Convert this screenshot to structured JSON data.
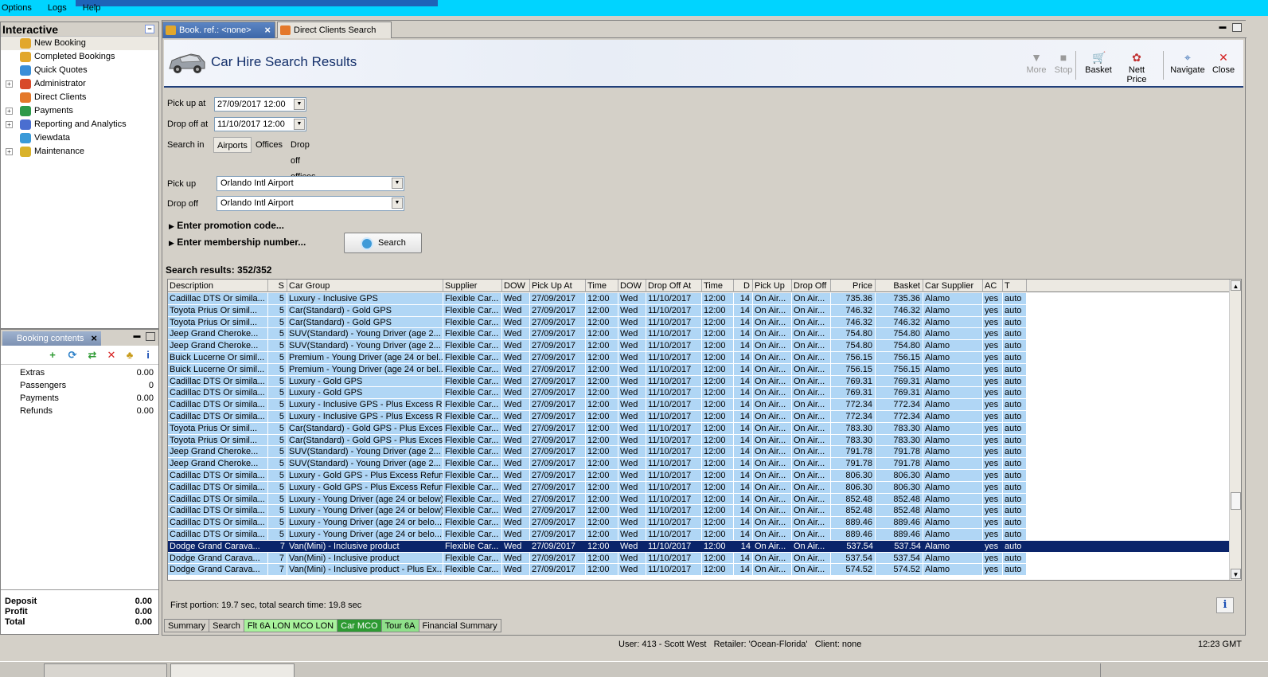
{
  "menu": {
    "options": "Options",
    "logs": "Logs",
    "help": "Help"
  },
  "leftnav": {
    "title": "Interactive",
    "collapse": "−",
    "items": [
      {
        "label": "New Booking",
        "icon": "palm-tree-icon",
        "expandable": false,
        "color": "#e2a72b",
        "selected": true
      },
      {
        "label": "Completed Bookings",
        "icon": "palm-tree-icon",
        "expandable": false,
        "color": "#e2a72b"
      },
      {
        "label": "Quick Quotes",
        "icon": "globe-icon",
        "expandable": false,
        "color": "#3a8ed8"
      },
      {
        "label": "Administrator",
        "icon": "person-icon",
        "expandable": true,
        "color": "#d84a2a"
      },
      {
        "label": "Direct Clients",
        "icon": "clients-icon",
        "expandable": false,
        "color": "#e4782a"
      },
      {
        "label": "Payments",
        "icon": "money-icon",
        "expandable": true,
        "color": "#2d9a4a"
      },
      {
        "label": "Reporting and Analytics",
        "icon": "chart-icon",
        "expandable": true,
        "color": "#4a6ed0"
      },
      {
        "label": "Viewdata",
        "icon": "viewdata-icon",
        "expandable": false,
        "color": "#3a9ad8"
      },
      {
        "label": "Maintenance",
        "icon": "books-icon",
        "expandable": true,
        "color": "#d9b22a"
      }
    ]
  },
  "booking": {
    "tab_label": "Booking contents",
    "close": "×",
    "tools": [
      {
        "icon": "add-icon",
        "glyph": "+",
        "color": "#2d9a32"
      },
      {
        "icon": "refresh-icon",
        "glyph": "⟳",
        "color": "#2a7fc8"
      },
      {
        "icon": "basket-icon",
        "glyph": "⇄",
        "color": "#2d9a32"
      },
      {
        "icon": "delete-icon",
        "glyph": "✕",
        "color": "#d62020"
      },
      {
        "icon": "palm-tree-icon",
        "glyph": "♣",
        "color": "#c89b1a"
      },
      {
        "icon": "info-icon",
        "glyph": "i",
        "color": "#1a4fb5"
      }
    ],
    "rows": [
      {
        "label": "Extras",
        "value": "0.00"
      },
      {
        "label": "Passengers",
        "value": "0"
      },
      {
        "label": "Payments",
        "value": "0.00"
      },
      {
        "label": "Refunds",
        "value": "0.00"
      }
    ],
    "totals": [
      {
        "label": "Deposit",
        "value": "0.00"
      },
      {
        "label": "Profit",
        "value": "0.00"
      },
      {
        "label": "Total",
        "value": "0.00"
      }
    ]
  },
  "tabs": [
    {
      "label": "Book. ref.: <none>",
      "active": true
    },
    {
      "label": "Direct Clients Search",
      "active": false
    }
  ],
  "header": {
    "title": "Car Hire Search Results"
  },
  "toolbar": [
    {
      "label": "More",
      "glyph": "▼",
      "disabled": true,
      "name": "more-button"
    },
    {
      "label": "Stop",
      "glyph": "■",
      "disabled": true,
      "name": "stop-button"
    },
    {
      "label": "Basket",
      "glyph": "🛒",
      "disabled": false,
      "name": "basket-button"
    },
    {
      "label": "Nett Price",
      "glyph": "✿",
      "disabled": false,
      "name": "nett-price-button"
    },
    {
      "label": "Navigate",
      "glyph": "⌖",
      "disabled": false,
      "name": "navigate-button"
    },
    {
      "label": "Close",
      "glyph": "✕",
      "disabled": false,
      "name": "close-button"
    }
  ],
  "form": {
    "pickup_label": "Pick up at",
    "pickup_value": "27/09/2017 12:00",
    "dropoff_label": "Drop off at",
    "dropoff_value": "11/10/2017 12:00",
    "searchin_label": "Search in",
    "searchin_options": [
      "Airports",
      "Offices",
      "Drop off offices"
    ],
    "pickup_loc_label": "Pick up",
    "pickup_loc_value": "Orlando Intl Airport",
    "dropoff_loc_label": "Drop off",
    "dropoff_loc_value": "Orlando Intl Airport",
    "promo": "Enter promotion code...",
    "membership": "Enter membership number...",
    "search_button": "Search"
  },
  "results": {
    "count_label": "Search results: 352/352",
    "columns": [
      "Description",
      "S",
      "Car Group",
      "Supplier",
      "DOW",
      "Pick Up At",
      "Time",
      "DOW",
      "Drop Off At",
      "Time",
      "D",
      "Pick Up",
      "Drop Off",
      "Price",
      "Basket",
      "Car Supplier",
      "AC",
      "T"
    ],
    "rows": [
      [
        "Cadillac DTS Or simila...",
        "5",
        "Luxury - Inclusive GPS",
        "Flexible Car...",
        "Wed",
        "27/09/2017",
        "12:00",
        "Wed",
        "11/10/2017",
        "12:00",
        "14",
        "On Air...",
        "On Air...",
        "735.36",
        "735.36",
        "Alamo",
        "yes",
        "auto"
      ],
      [
        "Toyota Prius Or simil...",
        "5",
        "Car(Standard) - Gold GPS",
        "Flexible Car...",
        "Wed",
        "27/09/2017",
        "12:00",
        "Wed",
        "11/10/2017",
        "12:00",
        "14",
        "On Air...",
        "On Air...",
        "746.32",
        "746.32",
        "Alamo",
        "yes",
        "auto"
      ],
      [
        "Toyota Prius Or simil...",
        "5",
        "Car(Standard) - Gold GPS",
        "Flexible Car...",
        "Wed",
        "27/09/2017",
        "12:00",
        "Wed",
        "11/10/2017",
        "12:00",
        "14",
        "On Air...",
        "On Air...",
        "746.32",
        "746.32",
        "Alamo",
        "yes",
        "auto"
      ],
      [
        "Jeep Grand Cheroke...",
        "5",
        "SUV(Standard) - Young Driver (age 2...",
        "Flexible Car...",
        "Wed",
        "27/09/2017",
        "12:00",
        "Wed",
        "11/10/2017",
        "12:00",
        "14",
        "On Air...",
        "On Air...",
        "754.80",
        "754.80",
        "Alamo",
        "yes",
        "auto"
      ],
      [
        "Jeep Grand Cheroke...",
        "5",
        "SUV(Standard) - Young Driver (age 2...",
        "Flexible Car...",
        "Wed",
        "27/09/2017",
        "12:00",
        "Wed",
        "11/10/2017",
        "12:00",
        "14",
        "On Air...",
        "On Air...",
        "754.80",
        "754.80",
        "Alamo",
        "yes",
        "auto"
      ],
      [
        "Buick Lucerne Or simil...",
        "5",
        "Premium - Young Driver (age 24 or bel...",
        "Flexible Car...",
        "Wed",
        "27/09/2017",
        "12:00",
        "Wed",
        "11/10/2017",
        "12:00",
        "14",
        "On Air...",
        "On Air...",
        "756.15",
        "756.15",
        "Alamo",
        "yes",
        "auto"
      ],
      [
        "Buick Lucerne Or simil...",
        "5",
        "Premium - Young Driver (age 24 or bel...",
        "Flexible Car...",
        "Wed",
        "27/09/2017",
        "12:00",
        "Wed",
        "11/10/2017",
        "12:00",
        "14",
        "On Air...",
        "On Air...",
        "756.15",
        "756.15",
        "Alamo",
        "yes",
        "auto"
      ],
      [
        "Cadillac DTS Or simila...",
        "5",
        "Luxury - Gold GPS",
        "Flexible Car...",
        "Wed",
        "27/09/2017",
        "12:00",
        "Wed",
        "11/10/2017",
        "12:00",
        "14",
        "On Air...",
        "On Air...",
        "769.31",
        "769.31",
        "Alamo",
        "yes",
        "auto"
      ],
      [
        "Cadillac DTS Or simila...",
        "5",
        "Luxury - Gold GPS",
        "Flexible Car...",
        "Wed",
        "27/09/2017",
        "12:00",
        "Wed",
        "11/10/2017",
        "12:00",
        "14",
        "On Air...",
        "On Air...",
        "769.31",
        "769.31",
        "Alamo",
        "yes",
        "auto"
      ],
      [
        "Cadillac DTS Or simila...",
        "5",
        "Luxury - Inclusive GPS - Plus Excess R...",
        "Flexible Car...",
        "Wed",
        "27/09/2017",
        "12:00",
        "Wed",
        "11/10/2017",
        "12:00",
        "14",
        "On Air...",
        "On Air...",
        "772.34",
        "772.34",
        "Alamo",
        "yes",
        "auto"
      ],
      [
        "Cadillac DTS Or simila...",
        "5",
        "Luxury - Inclusive GPS - Plus Excess R...",
        "Flexible Car...",
        "Wed",
        "27/09/2017",
        "12:00",
        "Wed",
        "11/10/2017",
        "12:00",
        "14",
        "On Air...",
        "On Air...",
        "772.34",
        "772.34",
        "Alamo",
        "yes",
        "auto"
      ],
      [
        "Toyota Prius Or simil...",
        "5",
        "Car(Standard) - Gold GPS - Plus Exces...",
        "Flexible Car...",
        "Wed",
        "27/09/2017",
        "12:00",
        "Wed",
        "11/10/2017",
        "12:00",
        "14",
        "On Air...",
        "On Air...",
        "783.30",
        "783.30",
        "Alamo",
        "yes",
        "auto"
      ],
      [
        "Toyota Prius Or simil...",
        "5",
        "Car(Standard) - Gold GPS - Plus Exces...",
        "Flexible Car...",
        "Wed",
        "27/09/2017",
        "12:00",
        "Wed",
        "11/10/2017",
        "12:00",
        "14",
        "On Air...",
        "On Air...",
        "783.30",
        "783.30",
        "Alamo",
        "yes",
        "auto"
      ],
      [
        "Jeep Grand Cheroke...",
        "5",
        "SUV(Standard) - Young Driver (age 2...",
        "Flexible Car...",
        "Wed",
        "27/09/2017",
        "12:00",
        "Wed",
        "11/10/2017",
        "12:00",
        "14",
        "On Air...",
        "On Air...",
        "791.78",
        "791.78",
        "Alamo",
        "yes",
        "auto"
      ],
      [
        "Jeep Grand Cheroke...",
        "5",
        "SUV(Standard) - Young Driver (age 2...",
        "Flexible Car...",
        "Wed",
        "27/09/2017",
        "12:00",
        "Wed",
        "11/10/2017",
        "12:00",
        "14",
        "On Air...",
        "On Air...",
        "791.78",
        "791.78",
        "Alamo",
        "yes",
        "auto"
      ],
      [
        "Cadillac DTS Or simila...",
        "5",
        "Luxury - Gold GPS - Plus Excess Refund",
        "Flexible Car...",
        "Wed",
        "27/09/2017",
        "12:00",
        "Wed",
        "11/10/2017",
        "12:00",
        "14",
        "On Air...",
        "On Air...",
        "806.30",
        "806.30",
        "Alamo",
        "yes",
        "auto"
      ],
      [
        "Cadillac DTS Or simila...",
        "5",
        "Luxury - Gold GPS - Plus Excess Refund",
        "Flexible Car...",
        "Wed",
        "27/09/2017",
        "12:00",
        "Wed",
        "11/10/2017",
        "12:00",
        "14",
        "On Air...",
        "On Air...",
        "806.30",
        "806.30",
        "Alamo",
        "yes",
        "auto"
      ],
      [
        "Cadillac DTS Or simila...",
        "5",
        "Luxury - Young Driver (age 24 or below)",
        "Flexible Car...",
        "Wed",
        "27/09/2017",
        "12:00",
        "Wed",
        "11/10/2017",
        "12:00",
        "14",
        "On Air...",
        "On Air...",
        "852.48",
        "852.48",
        "Alamo",
        "yes",
        "auto"
      ],
      [
        "Cadillac DTS Or simila...",
        "5",
        "Luxury - Young Driver (age 24 or below)",
        "Flexible Car...",
        "Wed",
        "27/09/2017",
        "12:00",
        "Wed",
        "11/10/2017",
        "12:00",
        "14",
        "On Air...",
        "On Air...",
        "852.48",
        "852.48",
        "Alamo",
        "yes",
        "auto"
      ],
      [
        "Cadillac DTS Or simila...",
        "5",
        "Luxury - Young Driver (age 24 or belo...",
        "Flexible Car...",
        "Wed",
        "27/09/2017",
        "12:00",
        "Wed",
        "11/10/2017",
        "12:00",
        "14",
        "On Air...",
        "On Air...",
        "889.46",
        "889.46",
        "Alamo",
        "yes",
        "auto"
      ],
      [
        "Cadillac DTS Or simila...",
        "5",
        "Luxury - Young Driver (age 24 or belo...",
        "Flexible Car...",
        "Wed",
        "27/09/2017",
        "12:00",
        "Wed",
        "11/10/2017",
        "12:00",
        "14",
        "On Air...",
        "On Air...",
        "889.46",
        "889.46",
        "Alamo",
        "yes",
        "auto"
      ],
      [
        "Dodge Grand Carava...",
        "7",
        "Van(Mini) - Inclusive product",
        "Flexible Car...",
        "Wed",
        "27/09/2017",
        "12:00",
        "Wed",
        "11/10/2017",
        "12:00",
        "14",
        "On Air...",
        "On Air...",
        "537.54",
        "537.54",
        "Alamo",
        "yes",
        "auto"
      ],
      [
        "Dodge Grand Carava...",
        "7",
        "Van(Mini) - Inclusive product",
        "Flexible Car...",
        "Wed",
        "27/09/2017",
        "12:00",
        "Wed",
        "11/10/2017",
        "12:00",
        "14",
        "On Air...",
        "On Air...",
        "537.54",
        "537.54",
        "Alamo",
        "yes",
        "auto"
      ],
      [
        "Dodge Grand Carava...",
        "7",
        "Van(Mini) - Inclusive product - Plus Ex...",
        "Flexible Car...",
        "Wed",
        "27/09/2017",
        "12:00",
        "Wed",
        "11/10/2017",
        "12:00",
        "14",
        "On Air...",
        "On Air...",
        "574.52",
        "574.52",
        "Alamo",
        "yes",
        "auto"
      ]
    ],
    "selected_row": 21,
    "timing": "First portion: 19.7 sec, total search time: 19.8 sec"
  },
  "bottom_tabs": [
    {
      "label": "Summary",
      "style": ""
    },
    {
      "label": "Search",
      "style": ""
    },
    {
      "label": "Flt 6A LON MCO LON",
      "style": "g1"
    },
    {
      "label": "Car MCO",
      "style": "g2"
    },
    {
      "label": "Tour 6A",
      "style": "g3"
    },
    {
      "label": "Financial Summary",
      "style": ""
    }
  ],
  "status": {
    "user": "User: 413 - Scott West   Retailer: 'Ocean-Florida'   Client: none",
    "clock": "12:23 GMT"
  }
}
